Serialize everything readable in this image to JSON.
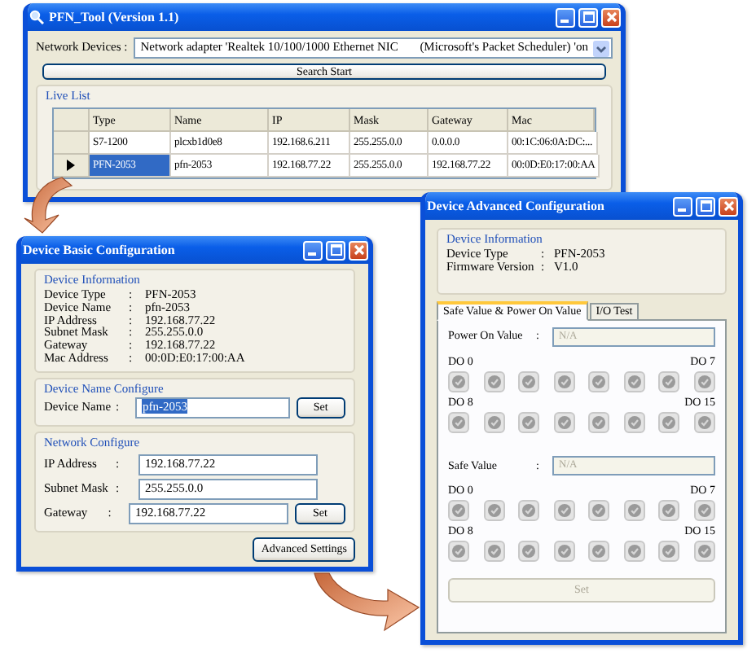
{
  "main_window": {
    "title": "PFN_Tool (Version 1.1)",
    "network_label": "Network Devices :",
    "adapter": "Network adapter 'Realtek 10/100/1000 Ethernet NIC",
    "adapter_suffix": "(Microsoft's Packet Scheduler) 'on",
    "search_button": "Search Start",
    "live_list": {
      "title": "Live List",
      "columns": [
        "Type",
        "Name",
        "IP",
        "Mask",
        "Gateway",
        "Mac"
      ],
      "rows": [
        {
          "selected": false,
          "cells": [
            "S7-1200",
            "plcxb1d0e8",
            "192.168.6.211",
            "255.255.0.0",
            "0.0.0.0",
            "00:1C:06:0A:DC:..."
          ]
        },
        {
          "selected": true,
          "cells": [
            "PFN-2053",
            "pfn-2053",
            "192.168.77.22",
            "255.255.0.0",
            "192.168.77.22",
            "00:0D:E0:17:00:AA"
          ]
        }
      ]
    }
  },
  "basic_window": {
    "title": "Device Basic Configuration",
    "info": {
      "title": "Device Information",
      "fields": [
        {
          "label": "Device Type",
          "sep": ":",
          "value": "PFN-2053"
        },
        {
          "label": "Device Name",
          "sep": ":",
          "value": "pfn-2053"
        },
        {
          "label": "IP Address",
          "sep": ":",
          "value": "192.168.77.22"
        },
        {
          "label": "Subnet Mask",
          "sep": ":",
          "value": "255.255.0.0"
        },
        {
          "label": "Gateway",
          "sep": ":",
          "value": "192.168.77.22"
        },
        {
          "label": "Mac Address",
          "sep": ":",
          "value": "00:0D:E0:17:00:AA"
        }
      ]
    },
    "name_group": {
      "title": "Device Name Configure",
      "label": "Device Name",
      "sep": ":",
      "value": "pfn-2053",
      "value_selected": true,
      "button": "Set"
    },
    "network_group": {
      "title": "Network Configure",
      "fields": [
        {
          "label": "IP Address",
          "sep": ":",
          "value": "192.168.77.22"
        },
        {
          "label": "Subnet Mask",
          "sep": ":",
          "value": "255.255.0.0"
        },
        {
          "label": "Gateway",
          "sep": ":",
          "value": "192.168.77.22"
        }
      ],
      "button": "Set"
    },
    "advanced_button": "Advanced Settings"
  },
  "advanced_window": {
    "title": "Device Advanced Configuration",
    "info": {
      "title": "Device Information",
      "fields": [
        {
          "label": "Device Type",
          "sep": ":",
          "value": "PFN-2053"
        },
        {
          "label": "Firmware Version",
          "sep": ":",
          "value": "V1.0"
        }
      ]
    },
    "tabs": [
      {
        "label": "Safe Value & Power On Value",
        "selected": true
      },
      {
        "label": "I/O Test",
        "selected": false
      }
    ],
    "sections": [
      {
        "label": "Power On Value",
        "sep": ":",
        "value": "N/A",
        "banks": [
          {
            "first": "DO 0",
            "last": "DO 7",
            "outputs": [
              {
                "on": false
              },
              {
                "on": false
              },
              {
                "on": false
              },
              {
                "on": false
              },
              {
                "on": false
              },
              {
                "on": false
              },
              {
                "on": false
              },
              {
                "on": false
              }
            ]
          },
          {
            "first": "DO 8",
            "last": "DO 15",
            "outputs": [
              {
                "on": false
              },
              {
                "on": false
              },
              {
                "on": false
              },
              {
                "on": false
              },
              {
                "on": false
              },
              {
                "on": false
              },
              {
                "on": false
              },
              {
                "on": false
              }
            ]
          }
        ]
      },
      {
        "label": "Safe Value",
        "sep": ":",
        "value": "N/A",
        "banks": [
          {
            "first": "DO 0",
            "last": "DO 7",
            "outputs": [
              {
                "on": false
              },
              {
                "on": false
              },
              {
                "on": false
              },
              {
                "on": false
              },
              {
                "on": false
              },
              {
                "on": false
              },
              {
                "on": false
              },
              {
                "on": false
              }
            ]
          },
          {
            "first": "DO 8",
            "last": "DO 15",
            "outputs": [
              {
                "on": false
              },
              {
                "on": false
              },
              {
                "on": false
              },
              {
                "on": false
              },
              {
                "on": false
              },
              {
                "on": false
              },
              {
                "on": false
              },
              {
                "on": false
              }
            ]
          }
        ]
      }
    ],
    "set_button": {
      "label": "Set",
      "disabled": true
    }
  }
}
